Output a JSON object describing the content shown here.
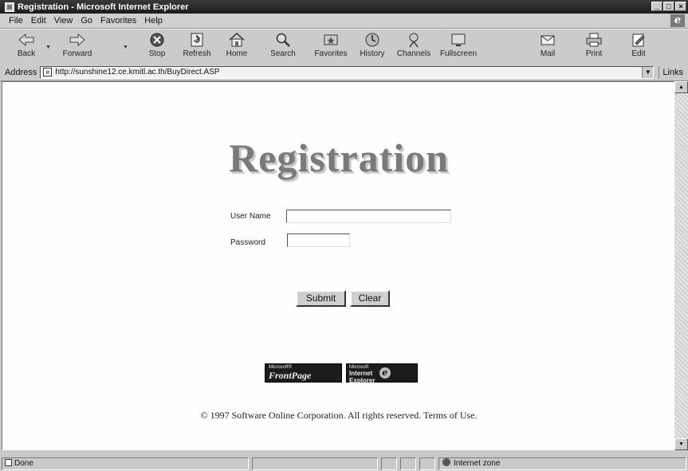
{
  "window": {
    "title": "Registration - Microsoft Internet Explorer",
    "buttons": [
      "_",
      "□",
      "×"
    ]
  },
  "menu": [
    "File",
    "Edit",
    "View",
    "Go",
    "Favorites",
    "Help"
  ],
  "toolbar": {
    "back": "Back",
    "forward": "Forward",
    "stop": "Stop",
    "refresh": "Refresh",
    "home": "Home",
    "search": "Search",
    "favorites": "Favorites",
    "history": "History",
    "channels": "Channels",
    "fullscreen": "Fullscreen",
    "mail": "Mail",
    "print": "Print",
    "edit": "Edit"
  },
  "address": {
    "label": "Address",
    "url": "http://sunshine12.ce.kmitl.ac.th/BuyDirect.ASP",
    "links": "Links"
  },
  "page": {
    "heading": "Registration",
    "username_label": "User Name",
    "username_value": "",
    "password_label": "Password",
    "password_value": "",
    "submit": "Submit",
    "clear": "Clear",
    "frontpage_small": "Microsoft®",
    "frontpage_main": "FrontPage",
    "ie_small": "Microsoft",
    "ie_line1": "Internet",
    "ie_line2": "Explorer",
    "copyright": "© 1997 Software Online Corporation. All rights reserved. Terms of Use."
  },
  "status": {
    "text": "Done",
    "zone": "Internet zone"
  },
  "icons": {
    "back": "back-arrow-icon",
    "forward": "forward-arrow-icon",
    "stop": "stop-icon",
    "refresh": "refresh-icon",
    "home": "home-icon",
    "search": "search-icon",
    "favorites": "favorites-icon",
    "history": "history-icon",
    "channels": "channels-icon",
    "fullscreen": "fullscreen-icon",
    "mail": "mail-icon",
    "print": "printer-icon",
    "edit": "edit-icon"
  }
}
